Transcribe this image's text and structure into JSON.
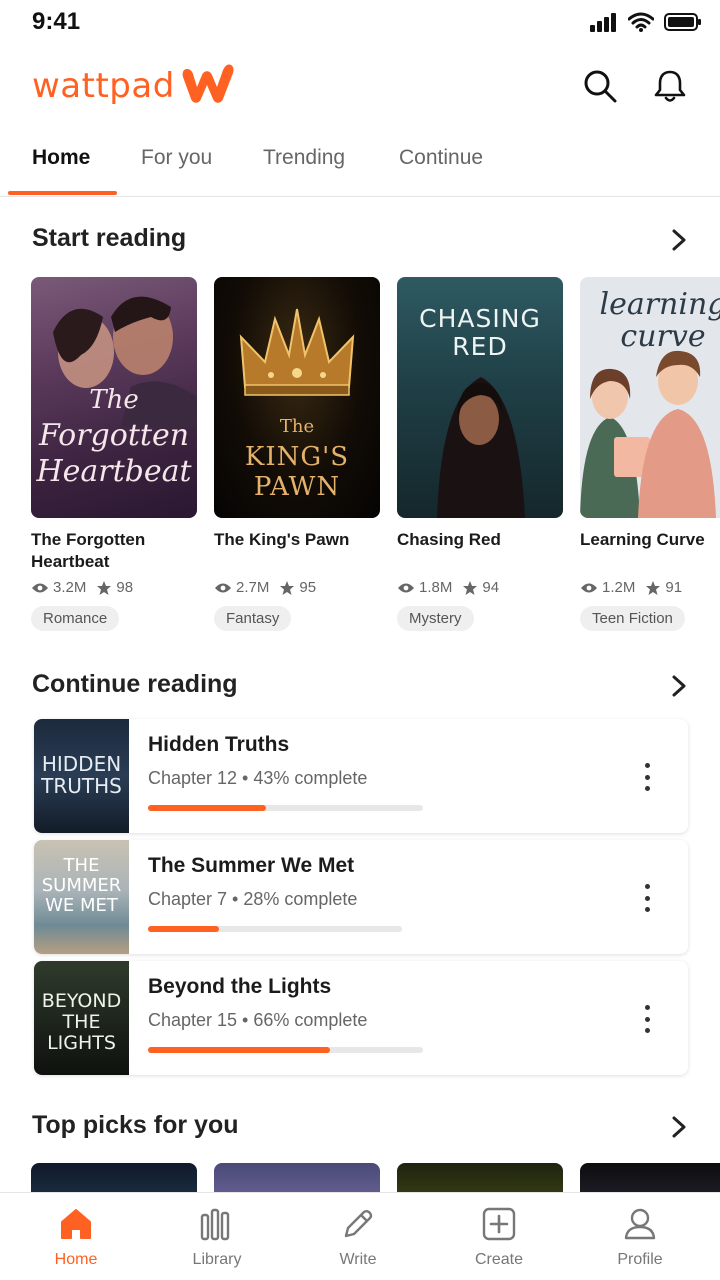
{
  "status_bar": {
    "time": "9:41"
  },
  "header": {
    "logo_text": "wattpad",
    "brand_color": "#FF6122",
    "icons": [
      "search-icon",
      "bell-icon"
    ]
  },
  "tabs": [
    {
      "label": "Home",
      "active": true
    },
    {
      "label": "For you",
      "active": false
    },
    {
      "label": "Trending",
      "active": false
    },
    {
      "label": "Continue",
      "active": false
    }
  ],
  "start_reading": {
    "title": "Start reading",
    "books": [
      {
        "title": "The Forgotten Heartbeat",
        "cover_text": [
          "The",
          "Forgotten",
          "Heartbeat"
        ],
        "reads": "3.2M",
        "votes": "98",
        "genre": "Romance"
      },
      {
        "title": "The King's Pawn",
        "cover_text": [
          "The",
          "KING'S",
          "PAWN"
        ],
        "reads": "2.7M",
        "votes": "95",
        "genre": "Fantasy"
      },
      {
        "title": "Chasing Red",
        "cover_text": [
          "CHASING",
          "RED"
        ],
        "reads": "1.8M",
        "votes": "94",
        "genre": "Mystery"
      },
      {
        "title": "Learning Curve",
        "cover_text": [
          "learning",
          "curve"
        ],
        "reads": "1.2M",
        "votes": "91",
        "genre": "Teen Fiction"
      }
    ]
  },
  "continue_reading": {
    "title": "Continue reading",
    "items": [
      {
        "title": "Hidden Truths",
        "subtitle": "Chapter 12 • 43% complete",
        "progress": 0.43,
        "thumb_text": [
          "HIDDEN",
          "TRUTHS"
        ]
      },
      {
        "title": "The Summer We Met",
        "subtitle": "Chapter 7 • 28% complete",
        "progress": 0.28,
        "thumb_text": [
          "THE",
          "SUMMER",
          "WE MET"
        ]
      },
      {
        "title": "Beyond the Lights",
        "subtitle": "Chapter 15 • 66% complete",
        "progress": 0.66,
        "thumb_text": [
          "BEYOND",
          "THE",
          "LIGHTS"
        ]
      }
    ]
  },
  "top_picks": {
    "title": "Top picks for you"
  },
  "bottom_nav": [
    {
      "label": "Home",
      "icon": "home-icon",
      "active": true
    },
    {
      "label": "Library",
      "icon": "library-icon",
      "active": false
    },
    {
      "label": "Write",
      "icon": "pencil-icon",
      "active": false
    },
    {
      "label": "Create",
      "icon": "plus-square-icon",
      "active": false
    },
    {
      "label": "Profile",
      "icon": "profile-icon",
      "active": false
    }
  ]
}
